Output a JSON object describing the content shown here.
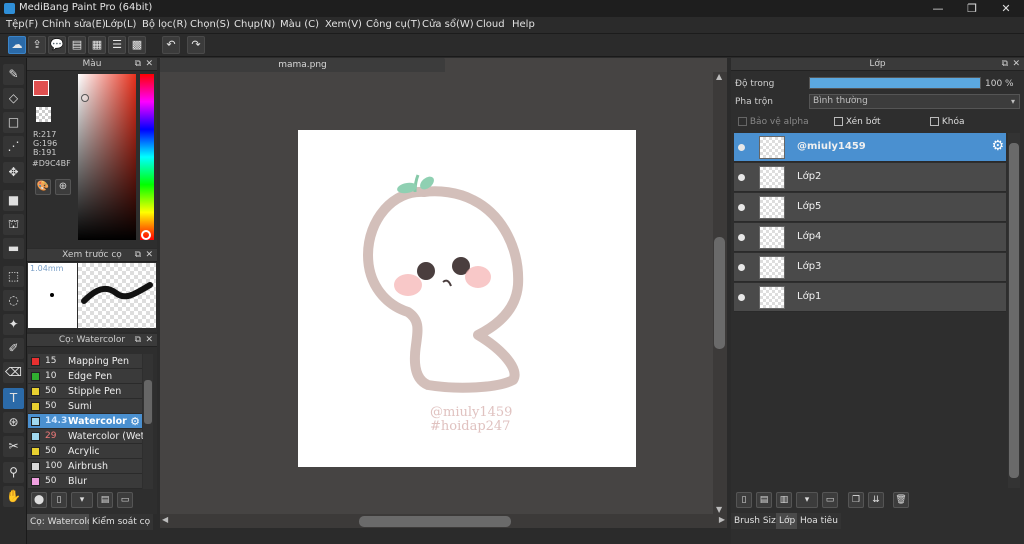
{
  "window": {
    "title": "MediBang Paint Pro (64bit)"
  },
  "window_controls": {
    "minimize": "—",
    "maximize": "❐",
    "close": "✕"
  },
  "menu": [
    "Tệp(F)",
    "Chỉnh sửa(E)",
    "Lớp(L)",
    "Bộ lọc(R)",
    "Chọn(S)",
    "Chụp(N)",
    "Màu (C)",
    "Xem(V)",
    "Công cụ(T)",
    "Cửa sổ(W)",
    "Cloud",
    "Help"
  ],
  "toolbar_icons": [
    "cloud-icon",
    "share-icon",
    "chat-icon",
    "comment-icon",
    "document-icon",
    "document-list-icon",
    "grid-icon",
    "undo-icon",
    "redo-icon"
  ],
  "color_panel": {
    "title": "Màu",
    "rgb": [
      "R:217",
      "G:196",
      "B:191"
    ],
    "hex": "#D9C4BF",
    "primary_color": "#e05050",
    "secondary_color": "#ffffff"
  },
  "brush_preview": {
    "title": "Xem trước cọ",
    "size_label": "1.04mm"
  },
  "brush_panel": {
    "title": "Cọ: Watercolor",
    "items": [
      {
        "size": "15",
        "name": "Mapping Pen",
        "color": "#e83030"
      },
      {
        "size": "10",
        "name": "Edge Pen",
        "color": "#30b030"
      },
      {
        "size": "50",
        "name": "Stipple Pen",
        "color": "#e8d030"
      },
      {
        "size": "50",
        "name": "Sumi",
        "color": "#e8d030"
      },
      {
        "size": "14.3",
        "name": "Watercolor",
        "color": "#a0d8f0",
        "selected": true
      },
      {
        "size": "29",
        "name": "Watercolor (Wet)",
        "color": "#a0d8f0"
      },
      {
        "size": "50",
        "name": "Acrylic",
        "color": "#e8d030"
      },
      {
        "size": "100",
        "name": "Airbrush",
        "color": "#d8d8d8"
      },
      {
        "size": "50",
        "name": "Blur",
        "color": "#f0a0e0"
      }
    ]
  },
  "left_bottom_tabs": [
    "Cọ: Watercolor",
    "Kiểm soát cọ"
  ],
  "document": {
    "tab": "mama.png",
    "watermark_line1": "@miuly1459",
    "watermark_line2": "#hoidap247"
  },
  "layer_panel": {
    "title": "Lớp",
    "opacity_label": "Độ trong",
    "opacity_value": "100 %",
    "opacity_fraction": 1.0,
    "blend_label": "Pha trộn",
    "blend_value": "Bình thường",
    "protect_alpha": "Bảo vệ alpha",
    "clipping": "Xén bớt",
    "lock": "Khóa",
    "layers": [
      {
        "name": "@miuly1459",
        "selected": true
      },
      {
        "name": "Lớp2"
      },
      {
        "name": "Lớp5"
      },
      {
        "name": "Lớp4"
      },
      {
        "name": "Lớp3"
      },
      {
        "name": "Lớp1"
      }
    ]
  },
  "right_bottom_tabs": [
    "Brush Size",
    "Lớp",
    "Hoa tiêu"
  ]
}
